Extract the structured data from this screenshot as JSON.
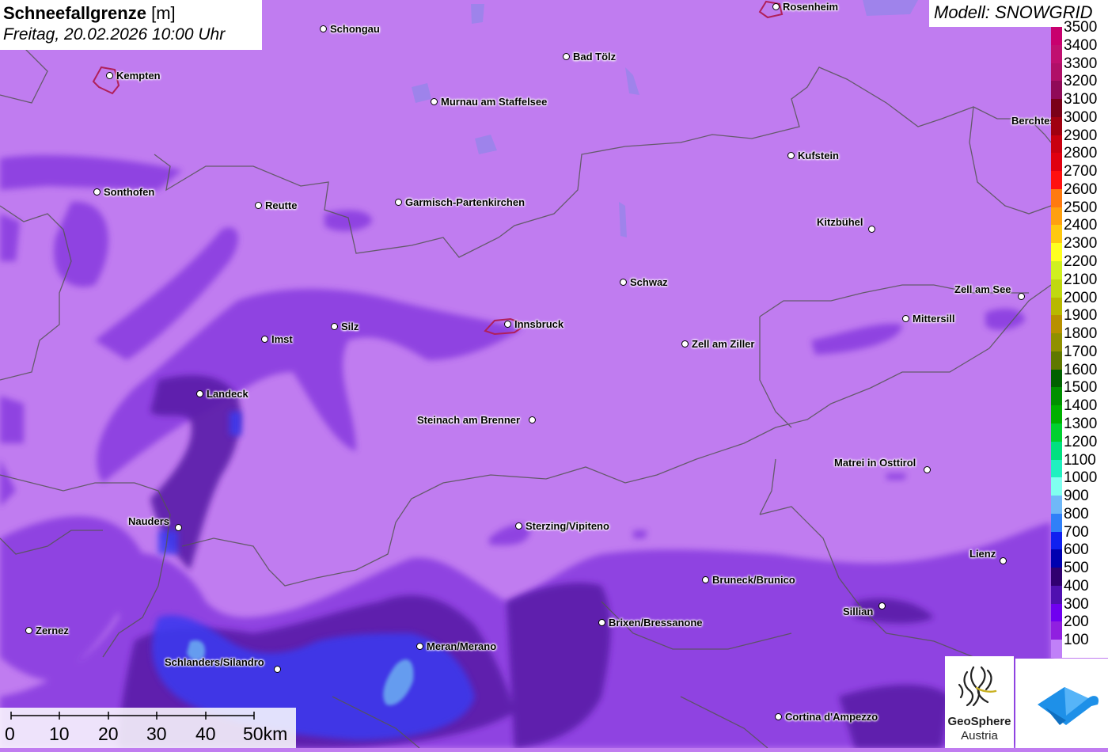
{
  "title": {
    "parameter": "Schneefallgrenze",
    "unit": "[m]",
    "datetime": "Freitag, 20.02.2026 10:00 Uhr"
  },
  "model_label": "Modell: SNOWGRID",
  "colors": {
    "background_fill": "#c07cf0",
    "higher_band": "#8a3ee0",
    "mid_band": "#5a1fa8",
    "low_band": "#3b3bf0",
    "lowest_band": "#6aa8f0",
    "border_line": "#555555",
    "city_outline": "#b0205a"
  },
  "cities": [
    {
      "name": "Rosenheim",
      "label_side": "right"
    },
    {
      "name": "Schongau",
      "label_side": "right"
    },
    {
      "name": "Bad Tölz",
      "label_side": "right"
    },
    {
      "name": "Kempten",
      "label_side": "right"
    },
    {
      "name": "Murnau am Staffelsee",
      "label_side": "right"
    },
    {
      "name": "Berchtesgaden",
      "label_side": "left"
    },
    {
      "name": "Kufstein",
      "label_side": "right"
    },
    {
      "name": "Sonthofen",
      "label_side": "right"
    },
    {
      "name": "Reutte",
      "label_side": "right"
    },
    {
      "name": "Garmisch-Partenkirchen",
      "label_side": "right"
    },
    {
      "name": "Kitzbühel",
      "label_side": "left"
    },
    {
      "name": "Schwaz",
      "label_side": "right"
    },
    {
      "name": "Zell am See",
      "label_side": "left"
    },
    {
      "name": "Mittersill",
      "label_side": "right"
    },
    {
      "name": "Innsbruck",
      "label_side": "right"
    },
    {
      "name": "Silz",
      "label_side": "right"
    },
    {
      "name": "Imst",
      "label_side": "right"
    },
    {
      "name": "Zell am Ziller",
      "label_side": "right"
    },
    {
      "name": "Landeck",
      "label_side": "right"
    },
    {
      "name": "Steinach am Brenner",
      "label_side": "left"
    },
    {
      "name": "Matrei in Osttirol",
      "label_side": "left"
    },
    {
      "name": "Nauders",
      "label_side": "left"
    },
    {
      "name": "Sterzing/Vipiteno",
      "label_side": "right"
    },
    {
      "name": "Lienz",
      "label_side": "left"
    },
    {
      "name": "Bruneck/Brunico",
      "label_side": "right"
    },
    {
      "name": "Sillian",
      "label_side": "left"
    },
    {
      "name": "Brixen/Bressanone",
      "label_side": "right"
    },
    {
      "name": "Zernez",
      "label_side": "right"
    },
    {
      "name": "Meran/Merano",
      "label_side": "right"
    },
    {
      "name": "Schlanders/Silandro",
      "label_side": "left"
    },
    {
      "name": "Cortina d'Ampezzo",
      "label_side": "right"
    }
  ],
  "legend": {
    "title": "Schneefallgrenze [m]",
    "entries": [
      {
        "label": "3500",
        "color": "#c8006e"
      },
      {
        "label": "3400",
        "color": "#c01070"
      },
      {
        "label": "3300",
        "color": "#b01068"
      },
      {
        "label": "3200",
        "color": "#900a58"
      },
      {
        "label": "3100",
        "color": "#7a0018"
      },
      {
        "label": "3000",
        "color": "#a00010"
      },
      {
        "label": "2900",
        "color": "#c80010"
      },
      {
        "label": "2800",
        "color": "#e00010"
      },
      {
        "label": "2700",
        "color": "#ff1010"
      },
      {
        "label": "2600",
        "color": "#ff7a10"
      },
      {
        "label": "2500",
        "color": "#ffa010"
      },
      {
        "label": "2400",
        "color": "#ffc810"
      },
      {
        "label": "2300",
        "color": "#ffff20"
      },
      {
        "label": "2200",
        "color": "#d0f020"
      },
      {
        "label": "2100",
        "color": "#c0d810"
      },
      {
        "label": "2000",
        "color": "#b8b800"
      },
      {
        "label": "1900",
        "color": "#b89000"
      },
      {
        "label": "1800",
        "color": "#909000"
      },
      {
        "label": "1700",
        "color": "#607800"
      },
      {
        "label": "1600",
        "color": "#006000"
      },
      {
        "label": "1500",
        "color": "#009000"
      },
      {
        "label": "1400",
        "color": "#00b000"
      },
      {
        "label": "1300",
        "color": "#00d030"
      },
      {
        "label": "1200",
        "color": "#00e080"
      },
      {
        "label": "1100",
        "color": "#20f0c0"
      },
      {
        "label": "1000",
        "color": "#80fff0"
      },
      {
        "label": "900",
        "color": "#70b8f8"
      },
      {
        "label": "800",
        "color": "#3080f8"
      },
      {
        "label": "700",
        "color": "#1020f0"
      },
      {
        "label": "600",
        "color": "#0000b0"
      },
      {
        "label": "500",
        "color": "#300070"
      },
      {
        "label": "400",
        "color": "#5010b0"
      },
      {
        "label": "300",
        "color": "#7000f0"
      },
      {
        "label": "200",
        "color": "#9020e0"
      },
      {
        "label": "100",
        "color": "#c080f8"
      }
    ]
  },
  "scale": {
    "ticks": [
      "0",
      "10",
      "20",
      "30",
      "40",
      "50km"
    ]
  },
  "logos": {
    "geosphere_line1": "GeoSphere",
    "geosphere_line2": "Austria"
  }
}
